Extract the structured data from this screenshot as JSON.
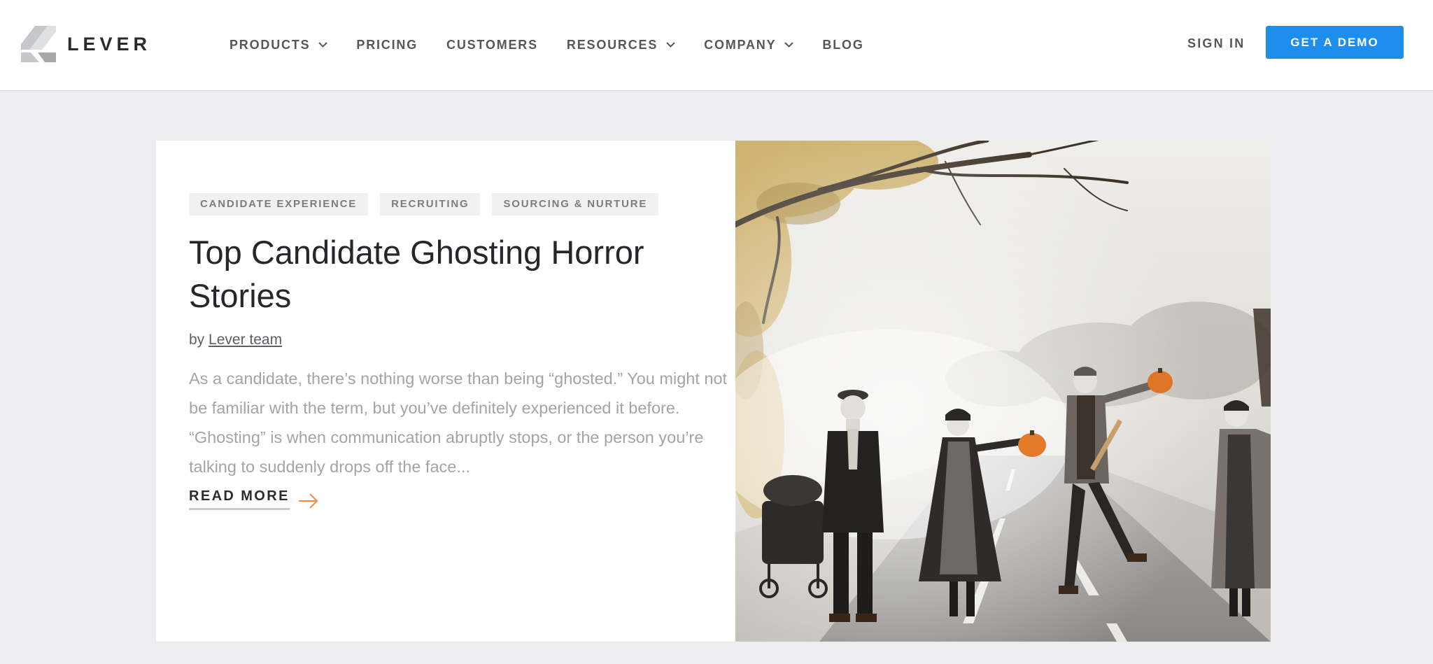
{
  "header": {
    "logo_text": "LEVER",
    "nav": [
      {
        "label": "PRODUCTS",
        "has_dropdown": true
      },
      {
        "label": "PRICING",
        "has_dropdown": false
      },
      {
        "label": "CUSTOMERS",
        "has_dropdown": false
      },
      {
        "label": "RESOURCES",
        "has_dropdown": true
      },
      {
        "label": "COMPANY",
        "has_dropdown": true
      },
      {
        "label": "BLOG",
        "has_dropdown": false
      }
    ],
    "sign_in": "SIGN IN",
    "cta": "GET A DEMO"
  },
  "post": {
    "tags": [
      "CANDIDATE EXPERIENCE",
      "RECRUITING",
      "SOURCING & NURTURE"
    ],
    "title": "Top Candidate Ghosting Horror Stories",
    "byline_prefix": "by",
    "author": "Lever team",
    "excerpt": "As a candidate, there’s nothing worse than being “ghosted.” You might not be familiar with the term, but you’ve definitely experienced it before. “Ghosting” is when communication abruptly stops, or the person you’re talking to suddenly drops off the face...",
    "read_more": "READ MORE"
  },
  "icons": {
    "logo": "lever-logo-icon",
    "dropdown": "chevron-down-icon",
    "arrow": "arrow-right-icon"
  },
  "colors": {
    "accent": "#1e8eec",
    "arrow": "#f08b45",
    "page_bg": "#ededef"
  }
}
